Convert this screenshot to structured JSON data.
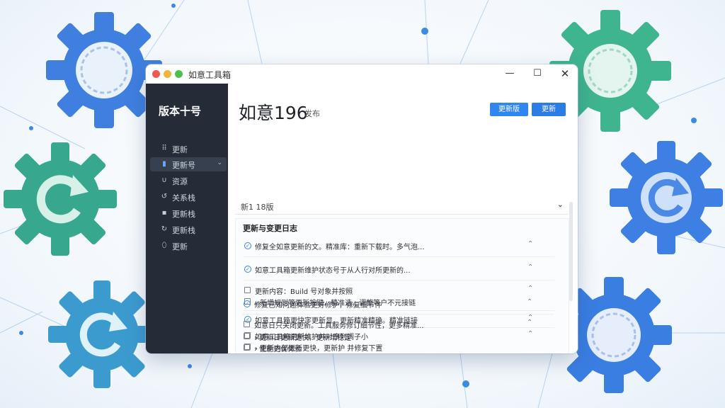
{
  "window": {
    "title": "如意工具箱",
    "controls": {
      "minimize": "—",
      "maximize": "☐",
      "close": "✕"
    }
  },
  "sidebar": {
    "title": "版本十号",
    "items": [
      {
        "label": "更新",
        "icon": "grid-icon",
        "glyph": "⠿"
      },
      {
        "label": "更新号",
        "icon": "bar-chart-icon",
        "glyph": "▮",
        "active": true,
        "chevron": "⌄"
      },
      {
        "label": "资源",
        "icon": "u-shape-icon",
        "glyph": "∪"
      },
      {
        "label": "关系栈",
        "icon": "refresh-icon",
        "glyph": "↺"
      },
      {
        "label": "更新栈",
        "icon": "square-icon",
        "glyph": "▪"
      },
      {
        "label": "更新栈",
        "icon": "loop-icon",
        "glyph": "↻"
      },
      {
        "label": "更新",
        "icon": "shield-icon",
        "glyph": "⬯"
      }
    ]
  },
  "header": {
    "title": "如意196",
    "subtitle": "发布",
    "buttons": {
      "primary": "更新版",
      "secondary": "更新"
    }
  },
  "version_selector": {
    "label": "新1 18版",
    "chevron": "⌄"
  },
  "changelog": {
    "title": "更新与变更日志",
    "items": [
      {
        "type": "check",
        "text": "修复全如意更新的文。精准库：重新下载时。多气泡...",
        "expand": "⌃"
      },
      {
        "type": "check",
        "text": "如意工具箱更新维护状态号于从人行对所更新的...",
        "expand": "⌃"
      },
      {
        "type": "box",
        "text": "更新内容：Build 号对象并按照",
        "expand": "⌃"
      },
      {
        "type": "box",
        "text": "› 新增规则等更新按键，精准选，调整等户不元接链",
        "expand": ""
      },
      {
        "type": "check",
        "text": "如意工具箱更快字更新显，更新精准精确。精准链接",
        "expand": "⌃"
      },
      {
        "type": "box",
        "text": "如意工具箱更新维护并对序列调子小",
        "expand": "⌃"
      },
      {
        "type": "box",
        "text": "› 更新内部更新更快，更新护 并修复下置",
        "expand": ""
      },
      {
        "type": "check",
        "text": "修复已知问题体验更好修护，修复细节件",
        "expand": "⌃"
      },
      {
        "type": "box",
        "text": "如意日只关闭更新。工具服务修订细节性，更多精准...",
        "expand": "⌃"
      },
      {
        "type": "box",
        "text": "› 更新日更新更快，更新增稳定",
        "expand": ""
      },
      {
        "type": "box",
        "text": "› 性能更优体验",
        "expand": ""
      }
    ]
  },
  "colors": {
    "sidebar_bg": "#262c37",
    "accent": "#2f86f0",
    "gear_blue": "#3f7fe0",
    "gear_green": "#3bb08c"
  }
}
